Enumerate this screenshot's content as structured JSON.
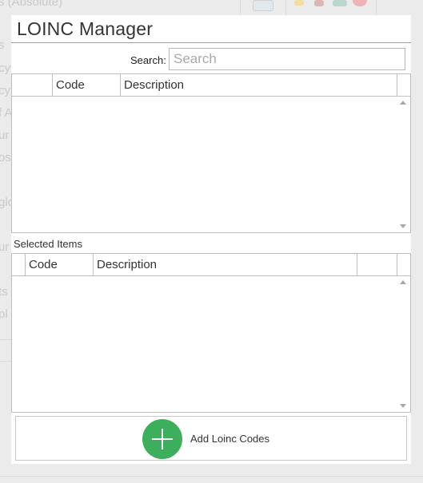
{
  "background": {
    "fragments": [
      "s (Absolute)",
      "s",
      "cyt",
      "cyt",
      "f A",
      "ur",
      "os",
      "glo",
      "ur",
      "ts",
      "pl"
    ]
  },
  "dialog": {
    "title": "LOINC Manager",
    "search": {
      "label": "Search:",
      "placeholder": "Search",
      "value": ""
    },
    "results_grid": {
      "columns": [
        "",
        "Code",
        "Description",
        ""
      ],
      "rows": []
    },
    "selected_label": "Selected Items",
    "selected_grid": {
      "columns": [
        "",
        "Code",
        "Description",
        "",
        ""
      ],
      "rows": []
    },
    "add_button": {
      "label": "Add Loinc Codes",
      "icon": "plus-circle-icon",
      "icon_color": "#3cae5c"
    }
  }
}
